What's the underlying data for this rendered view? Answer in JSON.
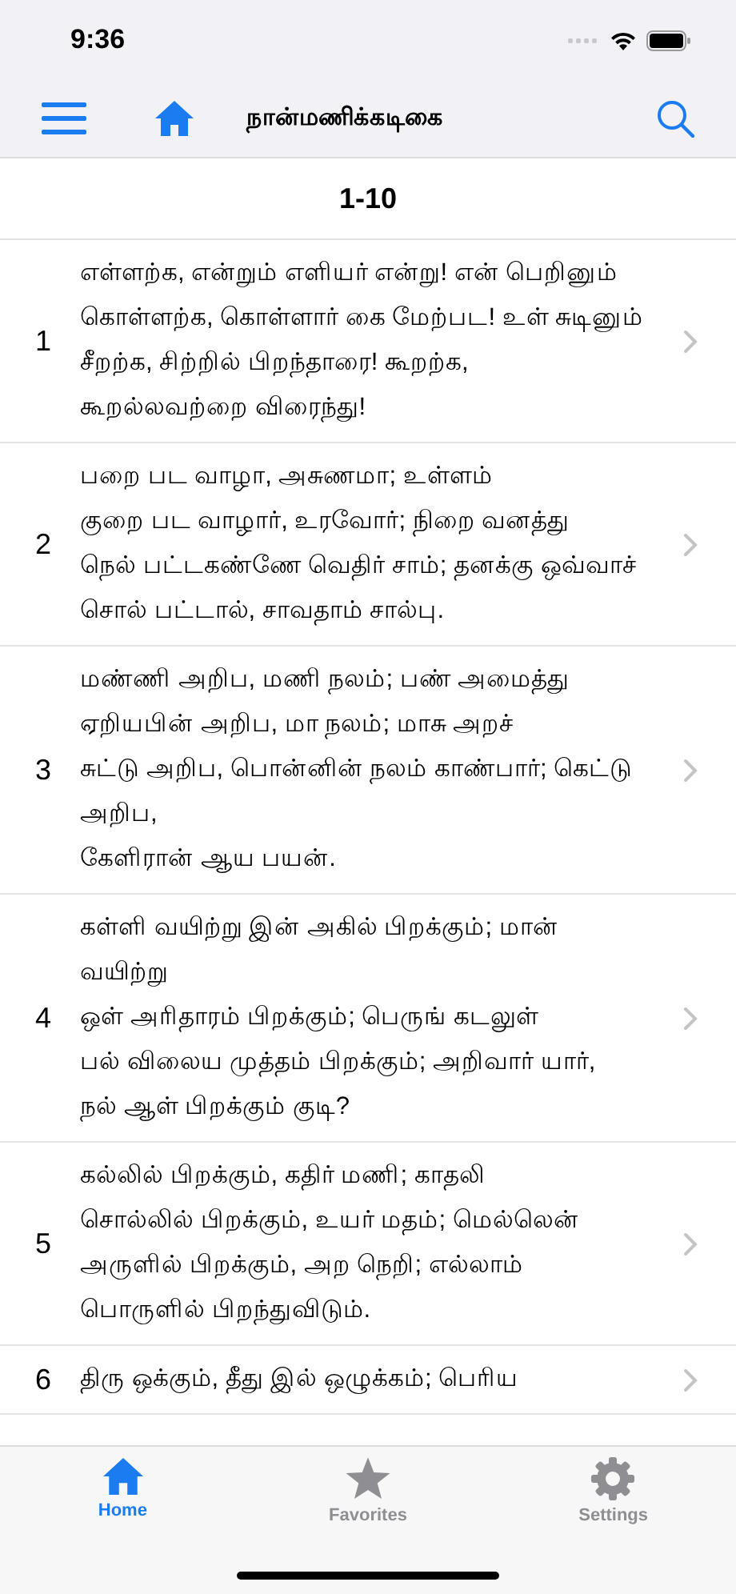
{
  "status_bar": {
    "time": "9:36"
  },
  "nav_bar": {
    "title": "நான்மணிக்கடிகை"
  },
  "section_header": "1-10",
  "verses": [
    {
      "number": "1",
      "lines": [
        "எள்ளற்க, என்றும் எளியர் என்று! என் பெறினும்",
        "கொள்ளற்க, கொள்ளார் கை மேற்பட! உள் சுடினும்",
        "சீறற்க, சிற்றில் பிறந்தாரை! கூறற்க,",
        "கூறல்லவற்றை விரைந்து!"
      ]
    },
    {
      "number": "2",
      "lines": [
        "பறை பட வாழா, அசுணமா; உள்ளம்",
        "குறை பட வாழார், உரவோர்; நிறை வனத்து",
        "நெல் பட்டகண்ணே வெதிர் சாம்; தனக்கு ஒவ்வாச்",
        "சொல் பட்டால், சாவதாம் சால்பு."
      ]
    },
    {
      "number": "3",
      "lines": [
        "மண்ணி அறிப, மணி நலம்; பண் அமைத்து",
        "ஏறியபின் அறிப, மா நலம்; மாசு அறச்",
        "சுட்டு அறிப, பொன்னின் நலம் காண்பார்; கெட்டு அறிப,",
        "கேளிரான் ஆய பயன்."
      ]
    },
    {
      "number": "4",
      "lines": [
        "கள்ளி வயிற்று இன் அகில் பிறக்கும்; மான் வயிற்று",
        "ஒள் அரிதாரம் பிறக்கும்; பெருங் கடலுள்",
        "பல் விலைய முத்தம் பிறக்கும்; அறிவார் யார்,",
        "நல் ஆள் பிறக்கும் குடி?"
      ]
    },
    {
      "number": "5",
      "lines": [
        "கல்லில் பிறக்கும், கதிர் மணி; காதலி",
        "சொல்லில் பிறக்கும், உயர் மதம்; மெல்லென்",
        "அருளில் பிறக்கும், அற நெறி; எல்லாம்",
        "பொருளில் பிறந்துவிடும்."
      ]
    },
    {
      "number": "6",
      "lines": [
        "திரு ஒக்கும், தீது இல் ஒழுக்கம்; பெரிய"
      ]
    }
  ],
  "tab_bar": [
    {
      "label": "Home",
      "kind": "home",
      "selected": true
    },
    {
      "label": "Favorites",
      "kind": "star",
      "selected": false
    },
    {
      "label": "Settings",
      "kind": "gear",
      "selected": false
    }
  ]
}
